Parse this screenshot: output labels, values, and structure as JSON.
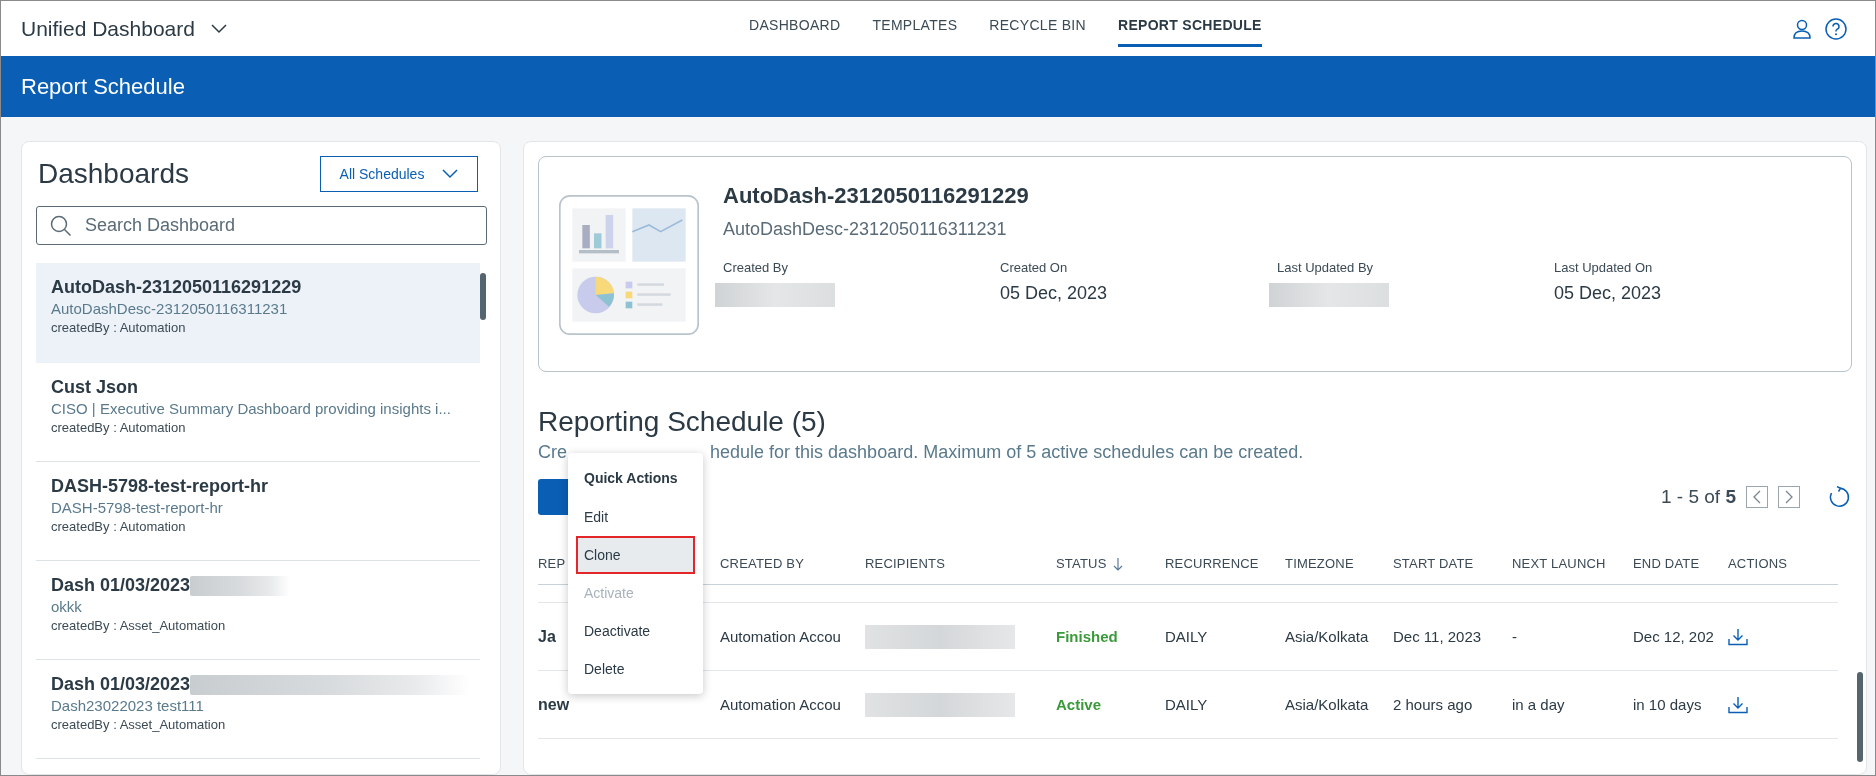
{
  "app": {
    "title": "Unified Dashboard"
  },
  "nav_tabs": [
    {
      "label": "DASHBOARD",
      "selected": false
    },
    {
      "label": "TEMPLATES",
      "selected": false
    },
    {
      "label": "RECYCLE BIN",
      "selected": false
    },
    {
      "label": "REPORT SCHEDULE",
      "selected": true
    }
  ],
  "banner": {
    "title": "Report Schedule"
  },
  "sidebar": {
    "title": "Dashboards",
    "filter": "All Schedules",
    "search": {
      "placeholder": "Search Dashboard"
    },
    "items": [
      {
        "name": "AutoDash-2312050116291229",
        "description": "AutoDashDesc-2312050116311231",
        "created_by": "createdBy : Automation",
        "selected": true,
        "redacted": false
      },
      {
        "name": "Cust Json",
        "description": "CISO | Executive Summary Dashboard providing insights i...",
        "created_by": "createdBy : Automation",
        "selected": false,
        "redacted": false
      },
      {
        "name": "DASH-5798-test-report-hr",
        "description": "DASH-5798-test-report-hr",
        "created_by": "createdBy : Automation",
        "selected": false,
        "redacted": false
      },
      {
        "name": "Dash 01/03/2023",
        "description": "okkk",
        "created_by": "createdBy : Asset_Automation",
        "selected": false,
        "redacted": true
      },
      {
        "name": "Dash 01/03/2023",
        "description": "Dash23022023 test111",
        "created_by": "createdBy : Asset_Automation",
        "selected": false,
        "redacted": true
      }
    ]
  },
  "details": {
    "title": "AutoDash-2312050116291229",
    "description": "AutoDashDesc-2312050116311231",
    "fields": [
      {
        "label": "Created By",
        "redacted": true
      },
      {
        "label": "Created On",
        "value": "05 Dec, 2023",
        "redacted": false
      },
      {
        "label": "Last Updated By",
        "redacted": true
      },
      {
        "label": "Last Updated On",
        "value": "05 Dec, 2023",
        "redacted": false
      }
    ]
  },
  "schedule": {
    "title": "Reporting Schedule (5)",
    "description_parts": [
      "Cre",
      "hedule for this dashboard. Maximum of 5 active schedules can be created."
    ],
    "pagination": "1 - 5 of **5**",
    "columns": [
      "REP",
      "CREATED BY",
      "RECIPIENTS",
      "STATUS",
      "RECURRENCE",
      "TIMEZONE",
      "START DATE",
      "NEXT LAUNCH",
      "END DATE",
      "ACTIONS"
    ],
    "rows": [
      {
        "name": "Ja",
        "created_by": "Automation Accou",
        "status": "Finished",
        "recurrence": "DAILY",
        "timezone": "Asia/Kolkata",
        "start_date": "Dec 11, 2023",
        "next_launch": "-",
        "end_date": "Dec 12, 202"
      },
      {
        "name": "new",
        "created_by": "Automation Accou",
        "status": "Active",
        "recurrence": "DAILY",
        "timezone": "Asia/Kolkata",
        "start_date": "2 hours ago",
        "next_launch": "in a day",
        "end_date": "in 10 days"
      }
    ]
  },
  "quick_actions": {
    "title": "Quick Actions",
    "items": [
      {
        "label": "Edit",
        "selected": false,
        "disabled": false
      },
      {
        "label": "Clone",
        "selected": true,
        "disabled": false
      },
      {
        "label": "Activate",
        "selected": false,
        "disabled": true
      },
      {
        "label": "Deactivate",
        "selected": false,
        "disabled": false
      },
      {
        "label": "Delete",
        "selected": false,
        "disabled": false
      }
    ]
  }
}
